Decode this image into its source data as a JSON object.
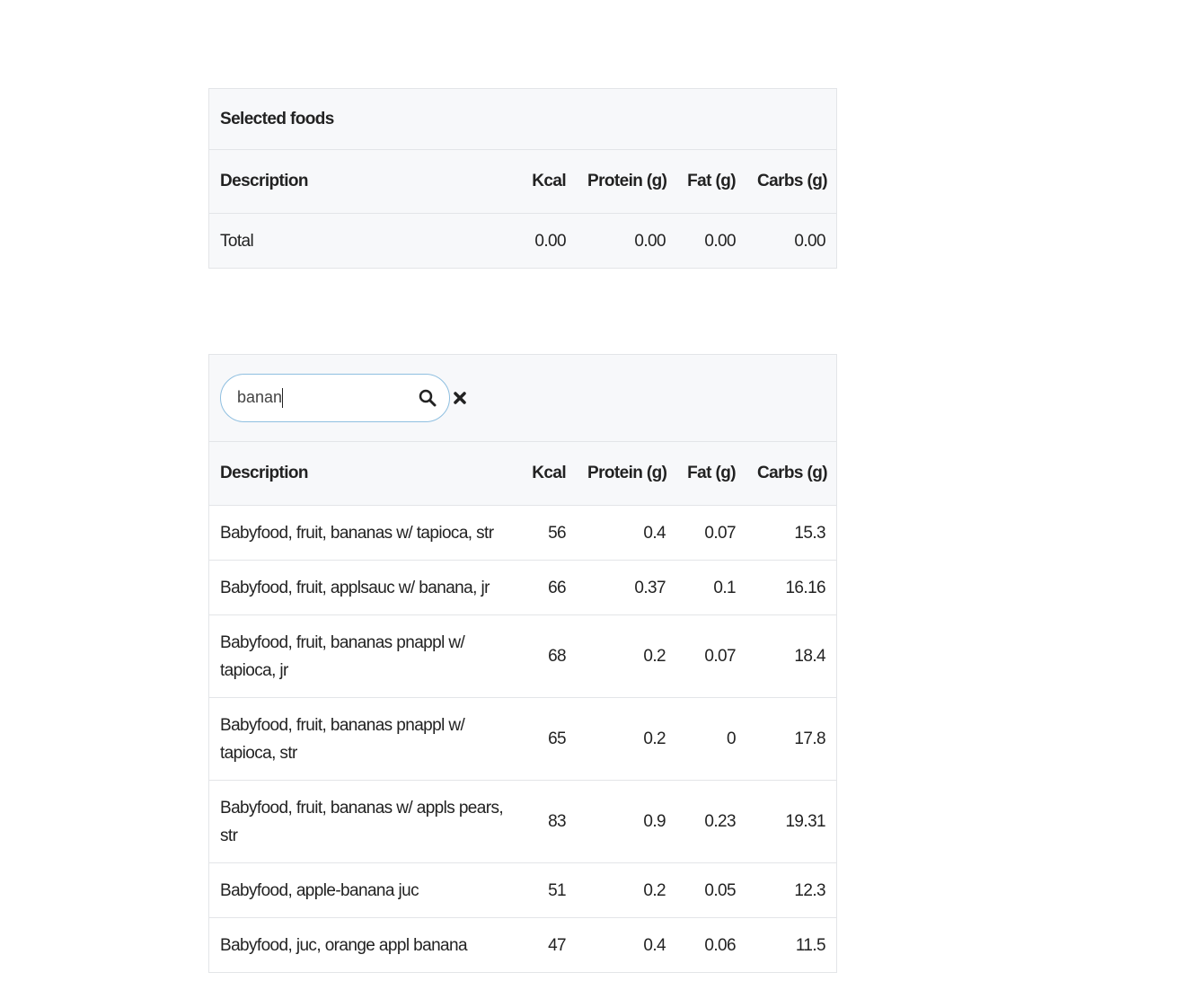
{
  "selected": {
    "title": "Selected foods",
    "total": {
      "label": "Total",
      "kcal": "0.00",
      "protein": "0.00",
      "fat": "0.00",
      "carbs": "0.00"
    }
  },
  "columns": [
    "Description",
    "Kcal",
    "Protein (g)",
    "Fat (g)",
    "Carbs (g)"
  ],
  "search": {
    "value": "banan",
    "search_icon": "magnifier",
    "clear_icon": "x-mark"
  },
  "results": [
    {
      "desc": "Babyfood, fruit, bananas w/ tapioca, str",
      "kcal": "56",
      "protein": "0.4",
      "fat": "0.07",
      "carbs": "15.3"
    },
    {
      "desc": "Babyfood, fruit, applsauc w/ banana, jr",
      "kcal": "66",
      "protein": "0.37",
      "fat": "0.1",
      "carbs": "16.16"
    },
    {
      "desc": "Babyfood, fruit, bananas pnappl w/ tapioca, jr",
      "kcal": "68",
      "protein": "0.2",
      "fat": "0.07",
      "carbs": "18.4"
    },
    {
      "desc": "Babyfood, fruit, bananas pnappl w/ tapioca, str",
      "kcal": "65",
      "protein": "0.2",
      "fat": "0",
      "carbs": "17.8"
    },
    {
      "desc": "Babyfood, fruit, bananas w/ appls pears, str",
      "kcal": "83",
      "protein": "0.9",
      "fat": "0.23",
      "carbs": "19.31"
    },
    {
      "desc": "Babyfood, apple-banana juc",
      "kcal": "51",
      "protein": "0.2",
      "fat": "0.05",
      "carbs": "12.3"
    },
    {
      "desc": "Babyfood, juc, orange appl banana",
      "kcal": "47",
      "protein": "0.4",
      "fat": "0.06",
      "carbs": "11.5"
    }
  ]
}
